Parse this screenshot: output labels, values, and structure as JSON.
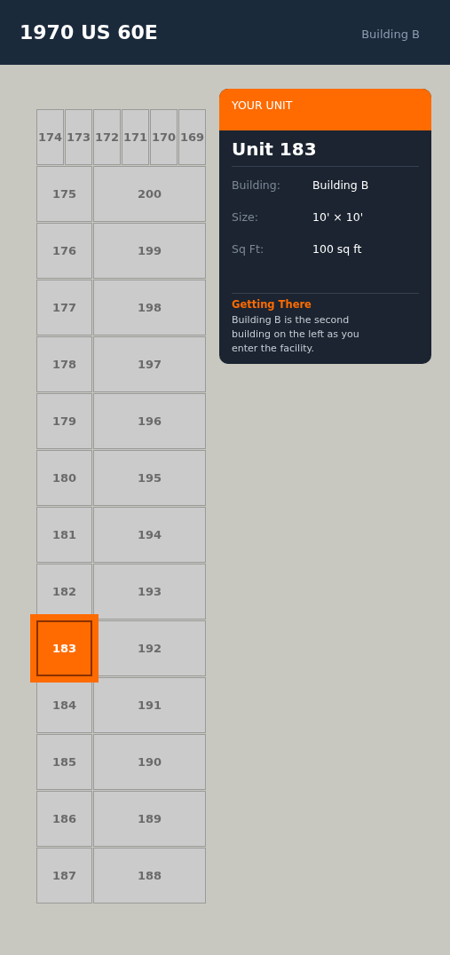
{
  "header": {
    "title": "1970 US 60E",
    "subtitle": "Building B"
  },
  "map": {
    "top_row": [
      {
        "label": "174",
        "selected": false
      },
      {
        "label": "173",
        "selected": false
      },
      {
        "label": "172",
        "selected": false
      },
      {
        "label": "171",
        "selected": false
      },
      {
        "label": "170",
        "selected": false
      },
      {
        "label": "169",
        "selected": false
      }
    ],
    "rows": [
      [
        {
          "label": "175",
          "selected": false
        },
        {
          "label": "200",
          "selected": false
        }
      ],
      [
        {
          "label": "176",
          "selected": false
        },
        {
          "label": "199",
          "selected": false
        }
      ],
      [
        {
          "label": "177",
          "selected": false
        },
        {
          "label": "198",
          "selected": false
        }
      ],
      [
        {
          "label": "178",
          "selected": false
        },
        {
          "label": "197",
          "selected": false
        }
      ],
      [
        {
          "label": "179",
          "selected": false
        },
        {
          "label": "196",
          "selected": false
        }
      ],
      [
        {
          "label": "180",
          "selected": false
        },
        {
          "label": "195",
          "selected": false
        }
      ],
      [
        {
          "label": "181",
          "selected": false
        },
        {
          "label": "194",
          "selected": false
        }
      ],
      [
        {
          "label": "182",
          "selected": false
        },
        {
          "label": "193",
          "selected": false
        }
      ],
      [
        {
          "label": "183",
          "selected": true
        },
        {
          "label": "192",
          "selected": false
        }
      ],
      [
        {
          "label": "184",
          "selected": false
        },
        {
          "label": "191",
          "selected": false
        }
      ],
      [
        {
          "label": "185",
          "selected": false
        },
        {
          "label": "190",
          "selected": false
        }
      ],
      [
        {
          "label": "186",
          "selected": false
        },
        {
          "label": "189",
          "selected": false
        }
      ],
      [
        {
          "label": "187",
          "selected": false
        },
        {
          "label": "188",
          "selected": false
        }
      ]
    ]
  },
  "card": {
    "heading": "YOUR UNIT",
    "title": "Unit 183",
    "details": [
      {
        "label": "Building:",
        "value": "Building B"
      },
      {
        "label": "Size:",
        "value": "10' × 10'"
      },
      {
        "label": "Sq Ft:",
        "value": "100 sq ft"
      }
    ],
    "directions_title": "Getting There",
    "directions": "Building B is the second building on the left as you enter the facility."
  }
}
